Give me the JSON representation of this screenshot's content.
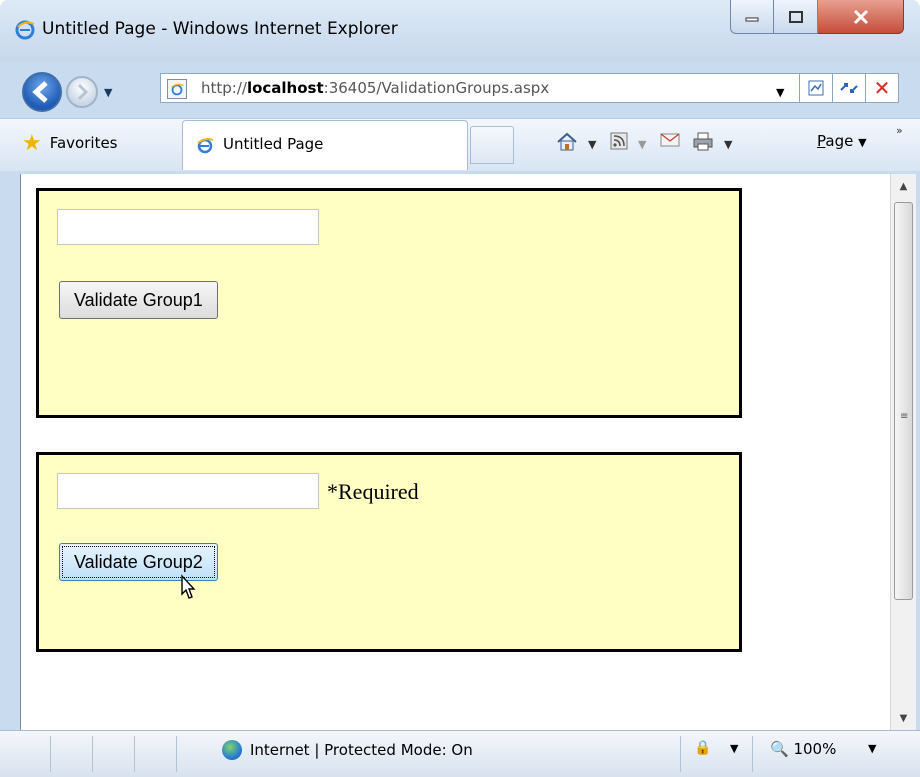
{
  "window": {
    "title": "Untitled Page - Windows Internet Explorer"
  },
  "navigation": {
    "address": {
      "prefix": "http://",
      "host": "localhost",
      "rest": ":36405/ValidationGroups.aspx"
    }
  },
  "toolbar": {
    "favorites_label": "Favorites",
    "tab_label": "Untitled Page",
    "page_menu": {
      "accel": "P",
      "rest": "age"
    }
  },
  "page": {
    "group1": {
      "button_label": "Validate Group1",
      "textbox_value": ""
    },
    "group2": {
      "button_label": "Validate Group2",
      "textbox_value": "",
      "validator_text": "*Required"
    },
    "colors": {
      "panel_background": "#ffffc4",
      "panel_border": "#000000"
    }
  },
  "statusbar": {
    "zone_text": "Internet | Protected Mode: On",
    "zoom_text": "100%"
  },
  "icons": {
    "ie_logo": "ie-logo-icon",
    "back": "back-arrow-icon",
    "forward": "forward-arrow-icon",
    "favorites": "star-icon",
    "home": "home-icon",
    "feeds": "rss-icon",
    "mail": "mail-icon",
    "print": "printer-icon",
    "globe": "globe-icon",
    "zoom": "magnifier-icon"
  }
}
